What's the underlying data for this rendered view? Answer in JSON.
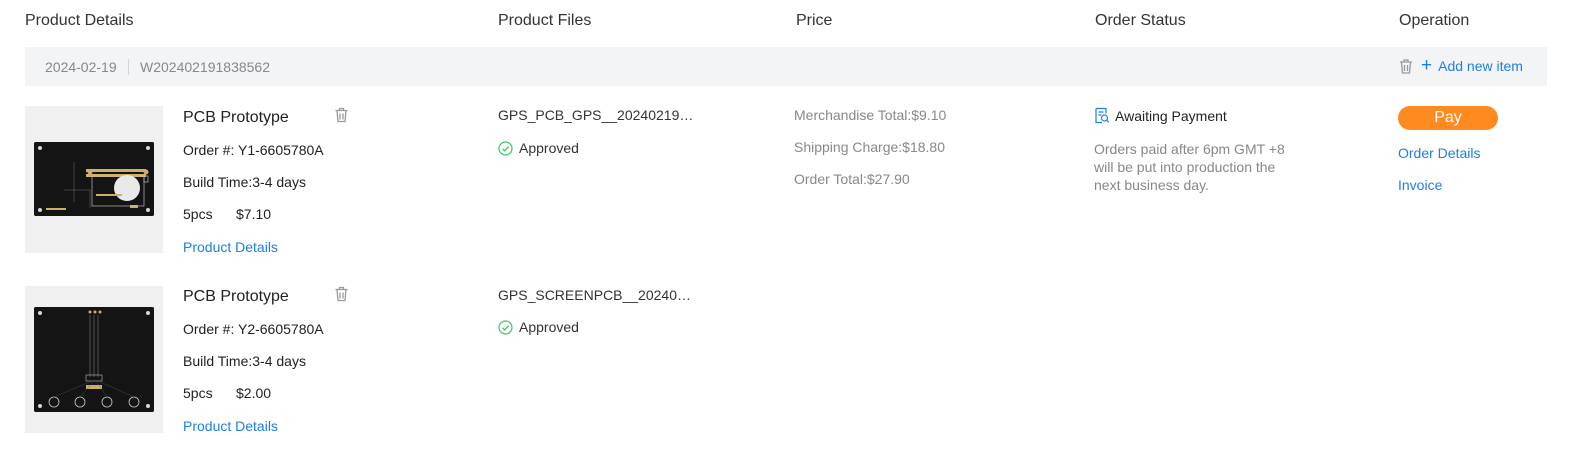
{
  "headers": {
    "product_details": "Product Details",
    "product_files": "Product Files",
    "price": "Price",
    "order_status": "Order Status",
    "operation": "Operation"
  },
  "order": {
    "date": "2024-02-19",
    "number": "W202402191838562",
    "add_item_label": "Add new item"
  },
  "items": [
    {
      "title": "PCB Prototype",
      "order_no": "Order #: Y1-6605780A",
      "build_time": "Build Time:3-4 days",
      "qty": "5pcs",
      "price": "$7.10",
      "details_link": "Product Details",
      "file_name": "GPS_PCB_GPS__20240219…",
      "file_status": "Approved"
    },
    {
      "title": "PCB Prototype",
      "order_no": "Order #: Y2-6605780A",
      "build_time": "Build Time:3-4 days",
      "qty": "5pcs",
      "price": "$2.00",
      "details_link": "Product Details",
      "file_name": "GPS_SCREENPCB__20240…",
      "file_status": "Approved"
    }
  ],
  "price": {
    "merchandise_total": "Merchandise Total:$9.10",
    "shipping_charge": "Shipping Charge:$18.80",
    "order_total": "Order Total:$27.90"
  },
  "status": {
    "label": "Awaiting Payment",
    "note": "Orders paid after 6pm GMT +8 will be put into production the next business day."
  },
  "operation": {
    "pay": "Pay",
    "order_details": "Order Details",
    "invoice": "Invoice"
  },
  "colors": {
    "accent": "#1f7fe0",
    "pay": "#ff8a1f",
    "approved": "#3cc46b",
    "bar": "#f3f4f6"
  },
  "icons": {
    "trash": "trash-icon",
    "add": "plus-icon",
    "approved": "check-circle-icon",
    "status": "payment-search-icon"
  }
}
